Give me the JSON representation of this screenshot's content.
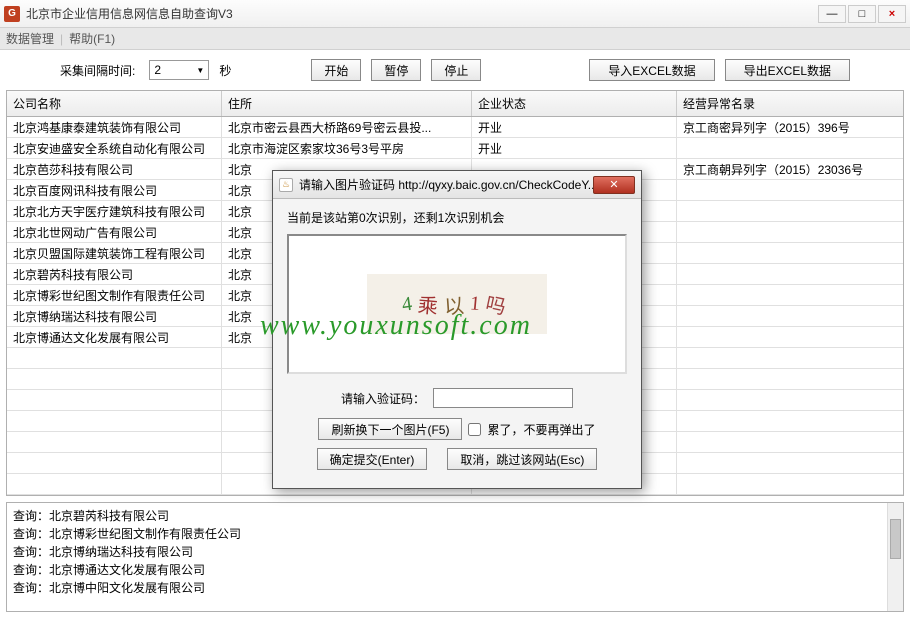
{
  "window": {
    "title": "北京市企业信用信息网信息自助查询V3",
    "icon_letter": "G"
  },
  "menu": {
    "data_manage": "数据管理",
    "help": "帮助(F1)"
  },
  "toolbar": {
    "interval_label": "采集间隔时间:",
    "interval_value": "2",
    "interval_unit": "秒",
    "start": "开始",
    "pause": "暂停",
    "stop": "停止",
    "import": "导入EXCEL数据",
    "export": "导出EXCEL数据"
  },
  "grid": {
    "headers": [
      "公司名称",
      "住所",
      "企业状态",
      "经营异常名录"
    ],
    "rows": [
      {
        "c0": "北京鸿基康泰建筑装饰有限公司",
        "c1": "北京市密云县西大桥路69号密云县投...",
        "c2": "开业",
        "c3": "京工商密异列字（2015）396号"
      },
      {
        "c0": "北京安迪盛安全系统自动化有限公司",
        "c1": "北京市海淀区索家坟36号3号平房",
        "c2": "开业",
        "c3": ""
      },
      {
        "c0": "北京芭莎科技有限公司",
        "c1": "北京",
        "c2": "",
        "c3": "京工商朝异列字（2015）23036号"
      },
      {
        "c0": "北京百度网讯科技有限公司",
        "c1": "北京",
        "c2": "",
        "c3": ""
      },
      {
        "c0": "北京北方天宇医疗建筑科技有限公司",
        "c1": "北京",
        "c2": "",
        "c3": ""
      },
      {
        "c0": "北京北世网动广告有限公司",
        "c1": "北京",
        "c2": "",
        "c3": ""
      },
      {
        "c0": "北京贝盟国际建筑装饰工程有限公司",
        "c1": "北京",
        "c2": "",
        "c3": ""
      },
      {
        "c0": "北京碧芮科技有限公司",
        "c1": "北京",
        "c2": "",
        "c3": ""
      },
      {
        "c0": "北京博彩世纪图文制作有限责任公司",
        "c1": "北京",
        "c2": "",
        "c3": ""
      },
      {
        "c0": "北京博纳瑞达科技有限公司",
        "c1": "北京",
        "c2": "",
        "c3": ""
      },
      {
        "c0": "北京博通达文化发展有限公司",
        "c1": "北京",
        "c2": "",
        "c3": ""
      },
      {
        "c0": "",
        "c1": "",
        "c2": "",
        "c3": ""
      },
      {
        "c0": "",
        "c1": "",
        "c2": "",
        "c3": ""
      },
      {
        "c0": "",
        "c1": "",
        "c2": "",
        "c3": ""
      },
      {
        "c0": "",
        "c1": "",
        "c2": "",
        "c3": ""
      },
      {
        "c0": "",
        "c1": "",
        "c2": "",
        "c3": ""
      },
      {
        "c0": "",
        "c1": "",
        "c2": "",
        "c3": ""
      },
      {
        "c0": "",
        "c1": "",
        "c2": "",
        "c3": ""
      }
    ]
  },
  "log": {
    "lines": [
      "查询：北京碧芮科技有限公司",
      "查询：北京博彩世纪图文制作有限责任公司",
      "查询：北京博纳瑞达科技有限公司",
      "查询：北京博通达文化发展有限公司",
      "查询：北京博中阳文化发展有限公司"
    ]
  },
  "dialog": {
    "title": "请输入图片验证码 http://qyxy.baic.gov.cn/CheckCodeY...",
    "info": "当前是该站第0次识别，还剩1次识别机会",
    "captcha_text": "乘 以 1",
    "input_label": "请输入验证码：",
    "refresh": "刷新换下一个图片(F5)",
    "tired": "累了，不要再弹出了",
    "ok": "确定提交(Enter)",
    "cancel": "取消，跳过该网站(Esc)"
  },
  "watermark": "www.youxunsoft.com"
}
